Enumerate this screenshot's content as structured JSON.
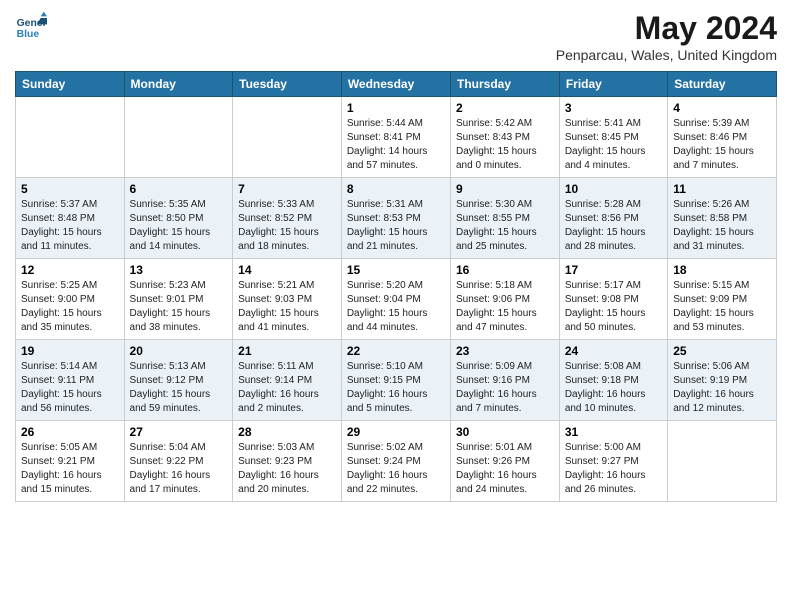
{
  "header": {
    "logo_line1": "General",
    "logo_line2": "Blue",
    "month_year": "May 2024",
    "location": "Penparcau, Wales, United Kingdom"
  },
  "weekdays": [
    "Sunday",
    "Monday",
    "Tuesday",
    "Wednesday",
    "Thursday",
    "Friday",
    "Saturday"
  ],
  "weeks": [
    [
      {
        "day": "",
        "content": ""
      },
      {
        "day": "",
        "content": ""
      },
      {
        "day": "",
        "content": ""
      },
      {
        "day": "1",
        "content": "Sunrise: 5:44 AM\nSunset: 8:41 PM\nDaylight: 14 hours\nand 57 minutes."
      },
      {
        "day": "2",
        "content": "Sunrise: 5:42 AM\nSunset: 8:43 PM\nDaylight: 15 hours\nand 0 minutes."
      },
      {
        "day": "3",
        "content": "Sunrise: 5:41 AM\nSunset: 8:45 PM\nDaylight: 15 hours\nand 4 minutes."
      },
      {
        "day": "4",
        "content": "Sunrise: 5:39 AM\nSunset: 8:46 PM\nDaylight: 15 hours\nand 7 minutes."
      }
    ],
    [
      {
        "day": "5",
        "content": "Sunrise: 5:37 AM\nSunset: 8:48 PM\nDaylight: 15 hours\nand 11 minutes."
      },
      {
        "day": "6",
        "content": "Sunrise: 5:35 AM\nSunset: 8:50 PM\nDaylight: 15 hours\nand 14 minutes."
      },
      {
        "day": "7",
        "content": "Sunrise: 5:33 AM\nSunset: 8:52 PM\nDaylight: 15 hours\nand 18 minutes."
      },
      {
        "day": "8",
        "content": "Sunrise: 5:31 AM\nSunset: 8:53 PM\nDaylight: 15 hours\nand 21 minutes."
      },
      {
        "day": "9",
        "content": "Sunrise: 5:30 AM\nSunset: 8:55 PM\nDaylight: 15 hours\nand 25 minutes."
      },
      {
        "day": "10",
        "content": "Sunrise: 5:28 AM\nSunset: 8:56 PM\nDaylight: 15 hours\nand 28 minutes."
      },
      {
        "day": "11",
        "content": "Sunrise: 5:26 AM\nSunset: 8:58 PM\nDaylight: 15 hours\nand 31 minutes."
      }
    ],
    [
      {
        "day": "12",
        "content": "Sunrise: 5:25 AM\nSunset: 9:00 PM\nDaylight: 15 hours\nand 35 minutes."
      },
      {
        "day": "13",
        "content": "Sunrise: 5:23 AM\nSunset: 9:01 PM\nDaylight: 15 hours\nand 38 minutes."
      },
      {
        "day": "14",
        "content": "Sunrise: 5:21 AM\nSunset: 9:03 PM\nDaylight: 15 hours\nand 41 minutes."
      },
      {
        "day": "15",
        "content": "Sunrise: 5:20 AM\nSunset: 9:04 PM\nDaylight: 15 hours\nand 44 minutes."
      },
      {
        "day": "16",
        "content": "Sunrise: 5:18 AM\nSunset: 9:06 PM\nDaylight: 15 hours\nand 47 minutes."
      },
      {
        "day": "17",
        "content": "Sunrise: 5:17 AM\nSunset: 9:08 PM\nDaylight: 15 hours\nand 50 minutes."
      },
      {
        "day": "18",
        "content": "Sunrise: 5:15 AM\nSunset: 9:09 PM\nDaylight: 15 hours\nand 53 minutes."
      }
    ],
    [
      {
        "day": "19",
        "content": "Sunrise: 5:14 AM\nSunset: 9:11 PM\nDaylight: 15 hours\nand 56 minutes."
      },
      {
        "day": "20",
        "content": "Sunrise: 5:13 AM\nSunset: 9:12 PM\nDaylight: 15 hours\nand 59 minutes."
      },
      {
        "day": "21",
        "content": "Sunrise: 5:11 AM\nSunset: 9:14 PM\nDaylight: 16 hours\nand 2 minutes."
      },
      {
        "day": "22",
        "content": "Sunrise: 5:10 AM\nSunset: 9:15 PM\nDaylight: 16 hours\nand 5 minutes."
      },
      {
        "day": "23",
        "content": "Sunrise: 5:09 AM\nSunset: 9:16 PM\nDaylight: 16 hours\nand 7 minutes."
      },
      {
        "day": "24",
        "content": "Sunrise: 5:08 AM\nSunset: 9:18 PM\nDaylight: 16 hours\nand 10 minutes."
      },
      {
        "day": "25",
        "content": "Sunrise: 5:06 AM\nSunset: 9:19 PM\nDaylight: 16 hours\nand 12 minutes."
      }
    ],
    [
      {
        "day": "26",
        "content": "Sunrise: 5:05 AM\nSunset: 9:21 PM\nDaylight: 16 hours\nand 15 minutes."
      },
      {
        "day": "27",
        "content": "Sunrise: 5:04 AM\nSunset: 9:22 PM\nDaylight: 16 hours\nand 17 minutes."
      },
      {
        "day": "28",
        "content": "Sunrise: 5:03 AM\nSunset: 9:23 PM\nDaylight: 16 hours\nand 20 minutes."
      },
      {
        "day": "29",
        "content": "Sunrise: 5:02 AM\nSunset: 9:24 PM\nDaylight: 16 hours\nand 22 minutes."
      },
      {
        "day": "30",
        "content": "Sunrise: 5:01 AM\nSunset: 9:26 PM\nDaylight: 16 hours\nand 24 minutes."
      },
      {
        "day": "31",
        "content": "Sunrise: 5:00 AM\nSunset: 9:27 PM\nDaylight: 16 hours\nand 26 minutes."
      },
      {
        "day": "",
        "content": ""
      }
    ]
  ]
}
